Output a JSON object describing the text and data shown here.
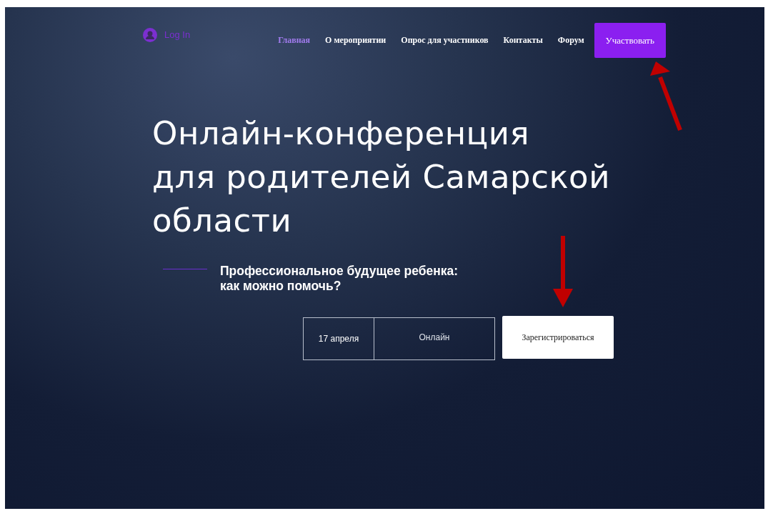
{
  "header": {
    "login": "Log In",
    "nav": [
      {
        "label": "Главная",
        "selected": true
      },
      {
        "label": "О мероприятии",
        "selected": false
      },
      {
        "label": "Опрос для участников",
        "selected": false
      },
      {
        "label": "Контакты",
        "selected": false
      },
      {
        "label": "Форум",
        "selected": false
      }
    ],
    "cta": "Участвовать"
  },
  "hero": {
    "title_lines": [
      "Онлайн-конференция",
      "для родителей Самарской",
      "области"
    ],
    "subtitle_lines": [
      "Профессиональное будущее ребенка:",
      "как можно помочь?"
    ],
    "date": "17 апреля",
    "format": "Онлайн",
    "register": "Зарегистрироваться"
  }
}
